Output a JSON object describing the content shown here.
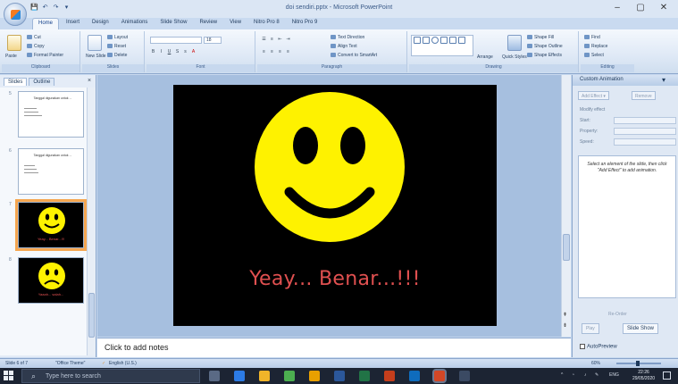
{
  "window": {
    "title": "doi sendiri.pptx - Microsoft PowerPoint",
    "controls": {
      "minimize": "–",
      "maximize": "▢",
      "close": "✕"
    }
  },
  "quick_access": {
    "save": "💾",
    "undo": "↶",
    "redo": "↷",
    "customize": "▾"
  },
  "ribbon": {
    "tabs": [
      "Home",
      "Insert",
      "Design",
      "Animations",
      "Slide Show",
      "Review",
      "View",
      "Nitro Pro 8",
      "Nitro Pro 9"
    ],
    "active_tab": "Home",
    "clipboard": {
      "label": "Clipboard",
      "paste": "Paste",
      "cut": "Cut",
      "copy": "Copy",
      "format_painter": "Format Painter"
    },
    "slides": {
      "label": "Slides",
      "new_slide": "New Slide",
      "layout": "Layout",
      "reset": "Reset",
      "delete": "Delete"
    },
    "font": {
      "label": "Font",
      "font_size": "18"
    },
    "paragraph": {
      "label": "Paragraph",
      "text_direction": "Text Direction",
      "align_text": "Align Text",
      "convert_smartart": "Convert to SmartArt"
    },
    "drawing": {
      "label": "Drawing",
      "arrange": "Arrange",
      "quick_styles": "Quick Styles",
      "shape_fill": "Shape Fill",
      "shape_outline": "Shape Outline",
      "shape_effects": "Shape Effects"
    },
    "editing": {
      "label": "Editing",
      "find": "Find",
      "replace": "Replace",
      "select": "Select"
    }
  },
  "left_pane": {
    "tabs": [
      "Slides",
      "Outline"
    ],
    "close": "×",
    "slides": [
      {
        "number": "5",
        "title": "Tanggal digunakan untuk ...",
        "style": "white",
        "caption": ""
      },
      {
        "number": "6",
        "title": "Tanggal digunakan untuk ...",
        "style": "white",
        "caption": ""
      },
      {
        "number": "7",
        "title": "",
        "style": "dark",
        "caption": "Yeay... Benar...!!!",
        "selected": true
      },
      {
        "number": "8",
        "title": "",
        "style": "dark",
        "caption": "Yaaah... salah...",
        "selected": false
      }
    ]
  },
  "slide": {
    "caption": "Yeay... Benar...!!!",
    "face_color": "#fef200",
    "background": "#000000",
    "caption_color": "#e05050"
  },
  "notes": {
    "placeholder": "Click to add notes"
  },
  "task_pane": {
    "title": "Custom Animation",
    "add_effect": "Add Effect ▾",
    "remove": "Remove",
    "modify_label": "Modify effect",
    "start_label": "Start:",
    "property_label": "Property:",
    "speed_label": "Speed:",
    "hint": "Select an element of the slide, then click \"Add Effect\" to add animation.",
    "reorder": "Re-Order",
    "play": "Play",
    "slide_show": "Slide Show",
    "autopreview": "AutoPreview"
  },
  "status_bar": {
    "slide_info": "Slide 6 of 7",
    "theme": "\"Office Theme\"",
    "language": "English (U.S.)",
    "zoom": "60%"
  },
  "taskbar": {
    "search_placeholder": "Type here to search",
    "language": "ENG",
    "time": "22:26",
    "date": "29/05/2020"
  }
}
